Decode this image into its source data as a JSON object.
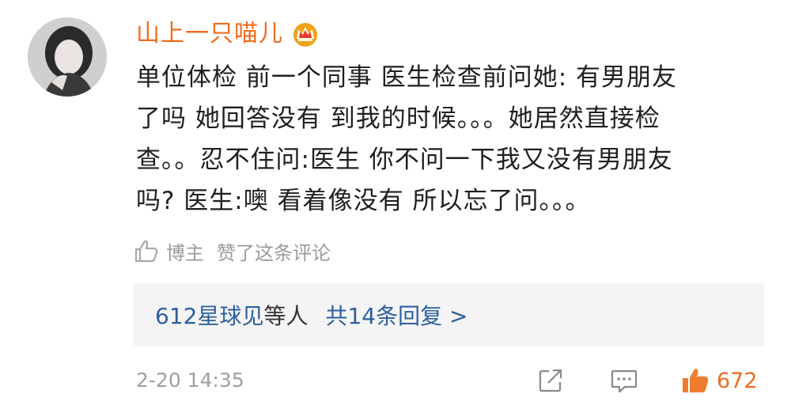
{
  "comment": {
    "username": "山上一只喵儿",
    "badge_icon": "crown-vip-icon",
    "text_lines": [
      "单位体检 前一个同事 医生检查前问她: 有男朋友",
      "了吗 她回答没有 到我的时候。。。她居然直接检",
      "查。。忍不住问:医生 你不问一下我又没有男朋友",
      "吗? 医生:噢 看着像没有 所以忘了问。。。"
    ],
    "liked_by": {
      "icon": "thumbs-up-outline-icon",
      "author": "博主",
      "text": "赞了这条评论"
    },
    "replies": {
      "who": "612星球见",
      "etc": "等人",
      "count_label": "共14条回复 >"
    },
    "footer": {
      "time": "2-20 14:35",
      "share_icon": "share-icon",
      "comment_icon": "comment-icon",
      "like_icon": "thumbs-up-filled-icon",
      "like_count": "672"
    },
    "colors": {
      "username": "#f06c1f",
      "link": "#2d5fa0",
      "muted": "#9b9b9b",
      "reply_bg": "#f4f4f4"
    }
  }
}
